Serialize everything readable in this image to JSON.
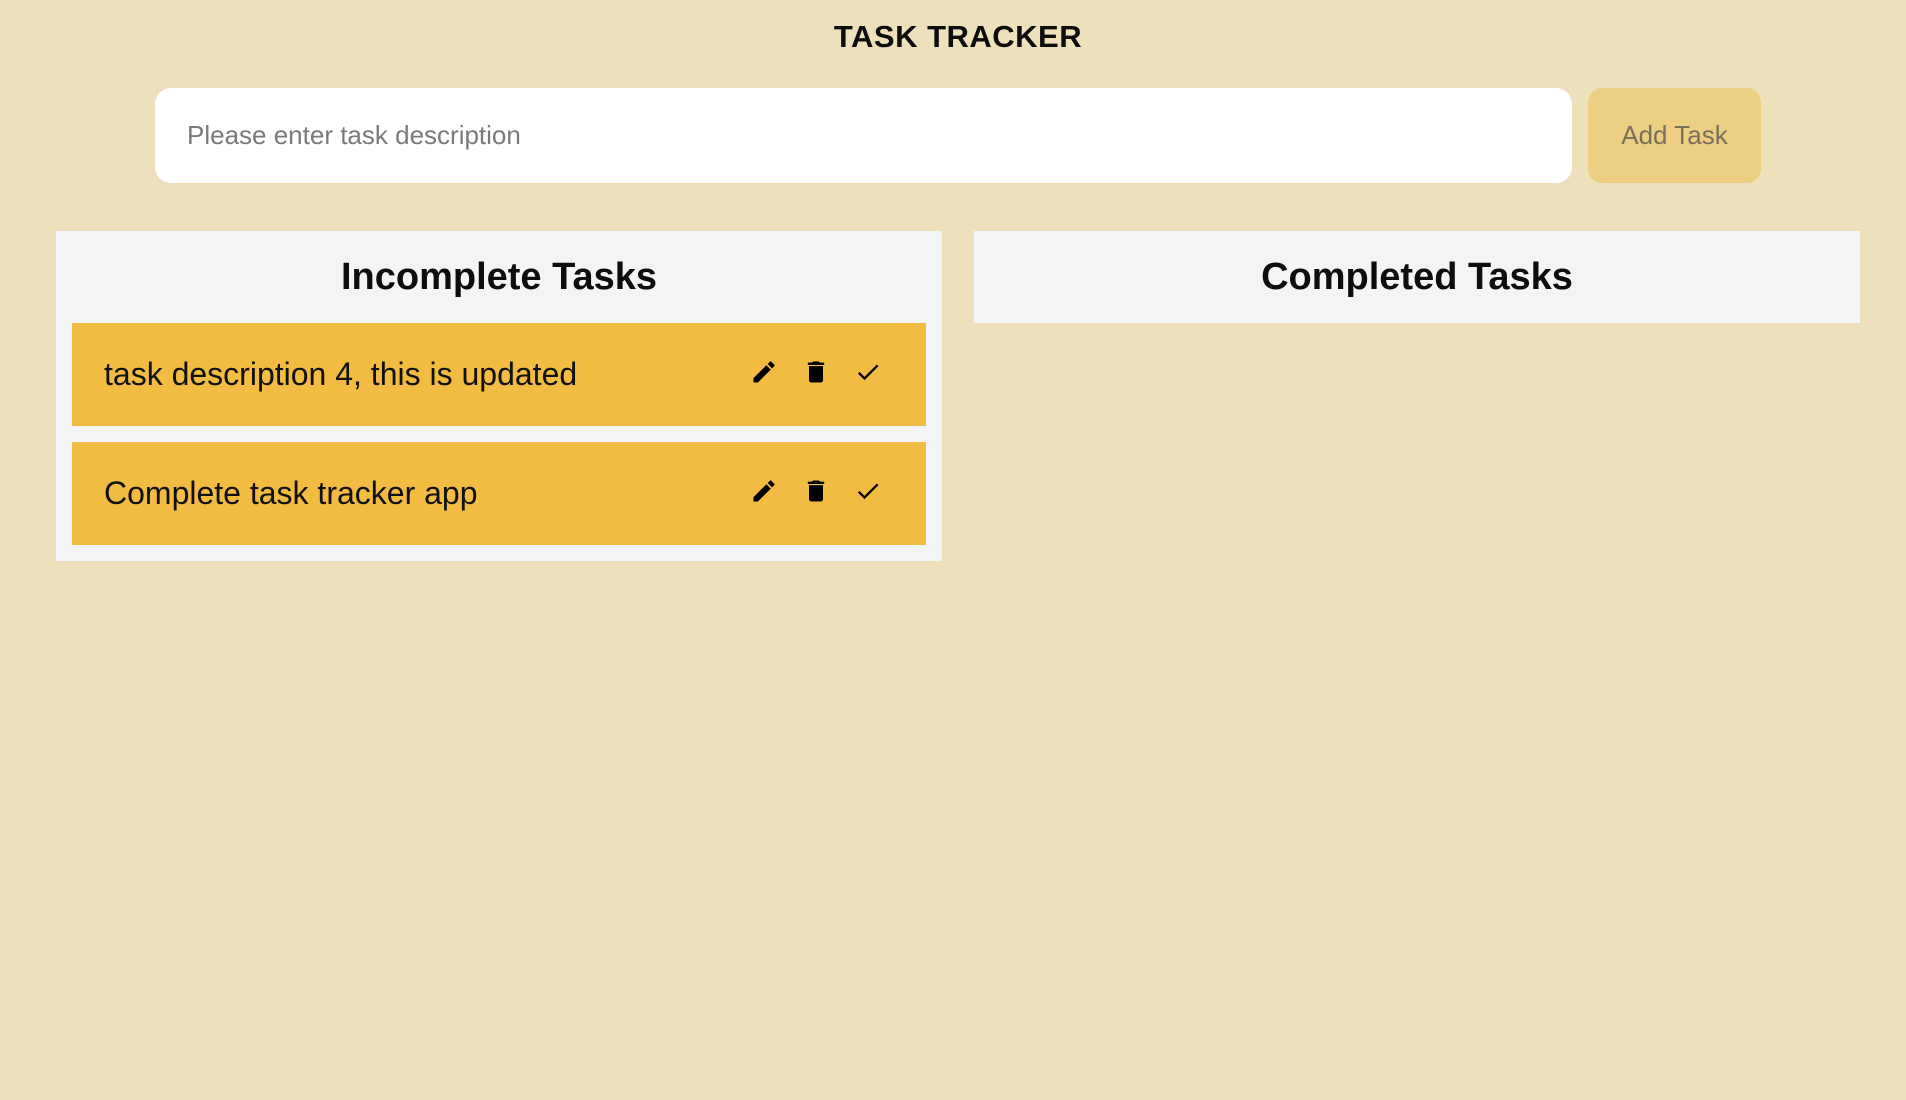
{
  "app": {
    "title": "TASK TRACKER"
  },
  "add_form": {
    "input_value": "",
    "input_placeholder": "Please enter task description",
    "add_button_label": "Add Task"
  },
  "incomplete": {
    "title": "Incomplete Tasks",
    "tasks": [
      {
        "text": "task description 4, this is updated",
        "actions": [
          "pencil-icon",
          "trash-icon",
          "check-icon"
        ]
      },
      {
        "text": "Complete task tracker app",
        "actions": [
          "pencil-icon",
          "trash-icon",
          "check-icon"
        ]
      }
    ]
  },
  "completed": {
    "title": "Completed Tasks",
    "tasks": []
  },
  "colors": {
    "background": "#ede0bb",
    "task_item": "#f2bb42",
    "add_button": "#edcf84",
    "panel": "#f3f4f6"
  }
}
